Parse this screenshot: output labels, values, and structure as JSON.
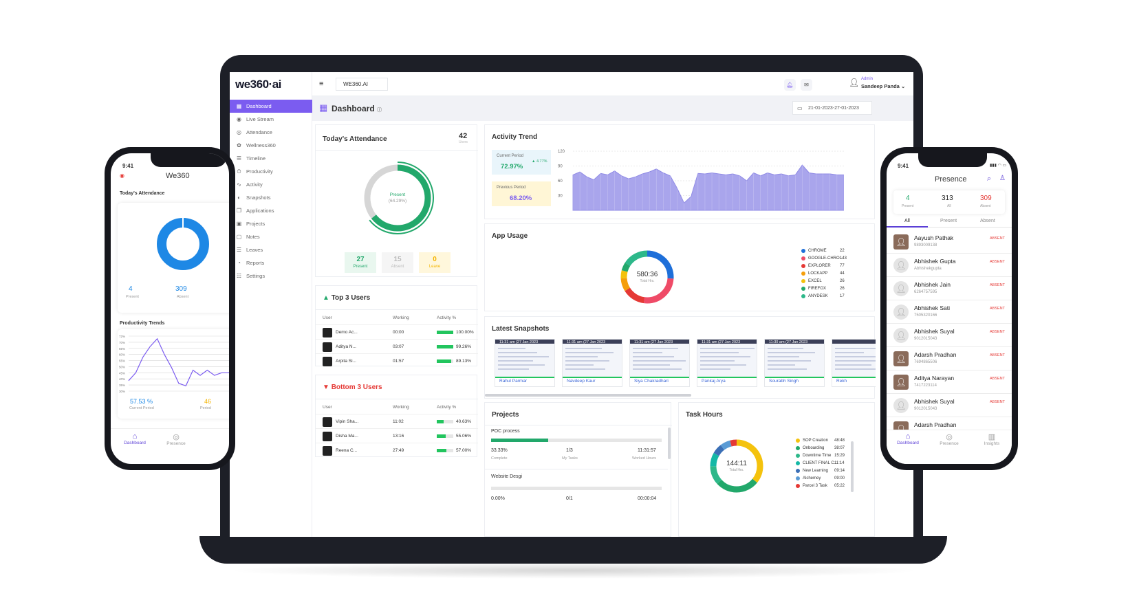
{
  "app": {
    "logo": "we360·ai",
    "org": "WE360.AI"
  },
  "sidebar": {
    "items": [
      {
        "label": "Dashboard",
        "icon": "grid-icon",
        "glyph": "▦",
        "active": true
      },
      {
        "label": "Live Stream",
        "icon": "broadcast-icon",
        "glyph": "◉"
      },
      {
        "label": "Attendance",
        "icon": "fingerprint-icon",
        "glyph": "◎"
      },
      {
        "label": "Wellness360",
        "icon": "wellness-icon",
        "glyph": "✿"
      },
      {
        "label": "Timeline",
        "icon": "timeline-icon",
        "glyph": "☰"
      },
      {
        "label": "Productivity",
        "icon": "stopwatch-icon",
        "glyph": "⏱"
      },
      {
        "label": "Activity",
        "icon": "pulse-icon",
        "glyph": "∿"
      },
      {
        "label": "Snapshots",
        "icon": "camera-icon",
        "glyph": "◐"
      },
      {
        "label": "Applications",
        "icon": "apps-icon",
        "glyph": "❐"
      },
      {
        "label": "Projects",
        "icon": "briefcase-icon",
        "glyph": "▣"
      },
      {
        "label": "Notes",
        "icon": "note-icon",
        "glyph": "▢"
      },
      {
        "label": "Leaves",
        "icon": "list-icon",
        "glyph": "☰"
      },
      {
        "label": "Reports",
        "icon": "report-icon",
        "glyph": "◔"
      },
      {
        "label": "Settings",
        "icon": "sliders-icon",
        "glyph": "☷"
      }
    ]
  },
  "topbar": {
    "user_role": "Admin",
    "user_name": "Sandeep Panda"
  },
  "page": {
    "title": "Dashboard",
    "date_range": "21-01-2023-27-01-2023"
  },
  "attendance": {
    "title": "Today's Attendance",
    "total": "42",
    "total_label": "Users",
    "center_label": "Present",
    "center_pct": "(64.29%)",
    "present": "27",
    "present_label": "Present",
    "absent": "15",
    "absent_label": "Absent",
    "leave": "0",
    "leave_label": "Leave",
    "colors": {
      "present": "#22a86b",
      "absent": "#d6d6d6"
    }
  },
  "top_users": {
    "title": "Top 3 Users",
    "headers": [
      "User",
      "Working",
      "Activity %"
    ],
    "rows": [
      {
        "name": "Demo Ac...",
        "working": "00:00",
        "pct": "100.00%",
        "value": 100
      },
      {
        "name": "Aditya N...",
        "working": "03:07",
        "pct": "99.26%",
        "value": 99.26
      },
      {
        "name": "Arpita Si...",
        "working": "01:57",
        "pct": "89.13%",
        "value": 89.13
      }
    ]
  },
  "bottom_users": {
    "title": "Bottom 3 Users",
    "headers": [
      "User",
      "Working",
      "Activity %"
    ],
    "rows": [
      {
        "name": "Vipin Sha...",
        "working": "11:02",
        "pct": "40.63%",
        "value": 40.63
      },
      {
        "name": "Disha Ma...",
        "working": "13:16",
        "pct": "55.06%",
        "value": 55.06
      },
      {
        "name": "Reena C...",
        "working": "27:49",
        "pct": "57.00%",
        "value": 57
      }
    ]
  },
  "activity_trend": {
    "title": "Activity Trend",
    "current_label": "Current Period",
    "current_value": "72.97%",
    "change": "▲ 4.77%",
    "previous_label": "Previous Period",
    "previous_value": "68.20%",
    "fill_color": "#a9a5ec"
  },
  "chart_data": {
    "type": "area",
    "ylim": [
      0,
      120
    ],
    "yticks": [
      "120",
      "90",
      "60",
      "30"
    ],
    "values": [
      72,
      78,
      68,
      62,
      75,
      72,
      80,
      70,
      64,
      68,
      74,
      78,
      84,
      76,
      70,
      45,
      15,
      28,
      75,
      74,
      76,
      74,
      72,
      74,
      70,
      60,
      76,
      70,
      76,
      72,
      74,
      70,
      72,
      92,
      76,
      74,
      74,
      74,
      72,
      72
    ]
  },
  "app_usage": {
    "title": "App Usage",
    "center": "580:36",
    "center_label": "Total Hrs.",
    "apps": [
      {
        "name": "CHROME",
        "val": "22",
        "color": "#1e6fd9",
        "share": 26
      },
      {
        "name": "GOOGLE-CHRO...",
        "val": "143",
        "color": "#ef4b67",
        "share": 26
      },
      {
        "name": "EXPLORER",
        "val": "77",
        "color": "#e53935",
        "share": 14
      },
      {
        "name": "LOCKAPP",
        "val": "44",
        "color": "#f59e0b",
        "share": 8
      },
      {
        "name": "EXCEL",
        "val": "26",
        "color": "#f4c20d",
        "share": 5
      },
      {
        "name": "FIREFOX",
        "val": "26",
        "color": "#22a86b",
        "share": 5
      },
      {
        "name": "ANYDESK",
        "val": "17",
        "color": "#2db88a",
        "share": 16
      }
    ]
  },
  "snapshots": {
    "title": "Latest Snapshots",
    "items": [
      {
        "time": "11:31 am (27 Jan 2023",
        "name": "Rahul Parmar"
      },
      {
        "time": "11:31 am (27 Jan 2023",
        "name": "Navdeep Kaur"
      },
      {
        "time": "11:31 am (27 Jan 2023",
        "name": "Siya Chakradhari"
      },
      {
        "time": "11:31 am (27 Jan 2023",
        "name": "Pankaj Arya"
      },
      {
        "time": "11:30 am (27 Jan 2023",
        "name": "Sourabh Singh"
      },
      {
        "time": "",
        "name": "Rekh"
      }
    ]
  },
  "projects": {
    "title": "Projects",
    "items": [
      {
        "name": "POC process",
        "progress": 0.333,
        "complete": "33.33%",
        "complete_label": "Complete",
        "tasks": "1/3",
        "tasks_label": "My Tasks",
        "hours": "11:31:57",
        "hours_label": "Worked Hours"
      },
      {
        "name": "Website Desgi",
        "progress": 0,
        "complete": "0.00%",
        "tasks": "0/1",
        "hours": "00:00:04"
      }
    ]
  },
  "task_hours": {
    "title": "Task Hours",
    "center": "144:11",
    "center_label": "Total Hrs.",
    "tasks": [
      {
        "name": "SOP Creation",
        "val": "48:48",
        "color": "#f4c20d",
        "share": 34
      },
      {
        "name": "Onboarding",
        "val": "38:07",
        "color": "#22a86b",
        "share": 26
      },
      {
        "name": "Downtime Time",
        "val": "15:29",
        "color": "#2db88a",
        "share": 11
      },
      {
        "name": "CLIENT FINAL C...",
        "val": "11:14",
        "color": "#14b8a6",
        "share": 8
      },
      {
        "name": "New Learning",
        "val": "09:14",
        "color": "#3b6fb6",
        "share": 6
      },
      {
        "name": "Alchemey",
        "val": "09:00",
        "color": "#5a9bd5",
        "share": 6
      },
      {
        "name": "Parcel 3 Task",
        "val": "05:22",
        "color": "#e53935",
        "share": 4
      }
    ]
  },
  "phone_left": {
    "time": "9:41",
    "title": "We360",
    "section": "Today's Attendance",
    "present": "4",
    "present_label": "Present",
    "absent": "309",
    "absent_label": "Absent",
    "trends_title": "Productivity Trends",
    "yticks": [
      "72%",
      "70%",
      "65%",
      "60%",
      "55%",
      "50%",
      "45%",
      "40%",
      "35%",
      "30%"
    ],
    "current": "57.53 %",
    "current_label": "Current Period",
    "prev": "46",
    "prev_label": "Period",
    "trend_values": [
      38,
      44,
      56,
      64,
      70,
      58,
      48,
      36,
      34,
      46,
      42,
      46,
      42,
      44,
      44,
      46
    ],
    "nav": [
      "Dashboard",
      "Presence"
    ]
  },
  "phone_right": {
    "time": "9:41",
    "title": "Presence",
    "present": "4",
    "present_label": "Present",
    "all": "313",
    "all_label": "All",
    "absent": "309",
    "absent_label": "Absent",
    "tabs": [
      "All",
      "Present",
      "Absent"
    ],
    "people": [
      {
        "name": "Aayush Pathak",
        "sub": "9893009138",
        "status": "ABSENT",
        "photo": true
      },
      {
        "name": "Abhishek Gupta",
        "sub": "Abhishekgupta",
        "status": "ABSENT"
      },
      {
        "name": "Abhishek Jain",
        "sub": "6264757595",
        "status": "ABSENT"
      },
      {
        "name": "Abhishek Sati",
        "sub": "7505320166",
        "status": "ABSENT"
      },
      {
        "name": "Abhishek Suyal",
        "sub": "9012015043",
        "status": "ABSENT"
      },
      {
        "name": "Adarsh Pradhan",
        "sub": "7694865506",
        "status": "ABSENT",
        "photo": true
      },
      {
        "name": "Aditya Narayan",
        "sub": "7417223114",
        "status": "ABSENT",
        "photo": true
      },
      {
        "name": "Abhishek Suyal",
        "sub": "9012015043",
        "status": "ABSENT"
      },
      {
        "name": "Adarsh Pradhan",
        "sub": "",
        "status": "",
        "photo": true
      }
    ],
    "nav": [
      "Dashboard",
      "Presence",
      "Insights"
    ]
  }
}
